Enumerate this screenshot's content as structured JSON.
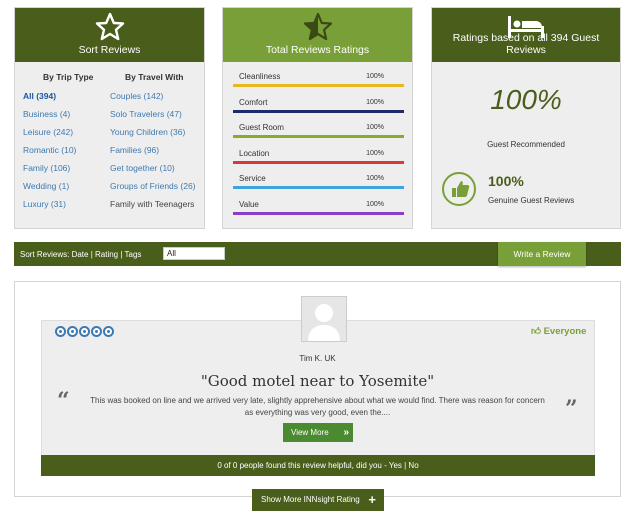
{
  "sort_panel": {
    "title": "Sort Reviews",
    "trip_type_header": "By Trip Type",
    "travel_with_header": "By Travel With",
    "trip_types": [
      "All (394)",
      "Business (4)",
      "Leisure (242)",
      "Romantic (10)",
      "Family (106)",
      "Wedding (1)",
      "Luxury (31)"
    ],
    "travel_with": [
      "Couples (142)",
      "Solo Travelers (47)",
      "Young Children (36)",
      "Families (96)",
      "Get together (10)",
      "Groups of Friends (26)",
      "Family with Teenagers"
    ]
  },
  "ratings_panel": {
    "title": "Total Reviews Ratings",
    "ratings": [
      {
        "label": "Cleanliness",
        "value": "100%",
        "color": "#e8b81e"
      },
      {
        "label": "Comfort",
        "value": "100%",
        "color": "#1d2b6b"
      },
      {
        "label": "Guest Room",
        "value": "100%",
        "color": "#8aaa2a"
      },
      {
        "label": "Location",
        "value": "100%",
        "color": "#d83a3a"
      },
      {
        "label": "Service",
        "value": "100%",
        "color": "#3ea4e0"
      },
      {
        "label": "Value",
        "value": "100%",
        "color": "#8a3ec8"
      }
    ]
  },
  "guest_panel": {
    "title": "Ratings based on all 394 Guest Reviews",
    "big_percent": "100%",
    "recommended_label": "Guest Recommended",
    "genuine_percent": "100%",
    "genuine_label": "Genuine Guest Reviews"
  },
  "sort_bar": {
    "label": "Sort Reviews: Date | Rating | Tags",
    "tag_value": "All",
    "write_review": "Write a Review"
  },
  "review": {
    "everyone_label": "Everyone",
    "reviewer": "Tim K.  UK",
    "title": "\"Good motel near to Yosemite\"",
    "body": "This was booked on line and we arrived very late, slightly apprehensive about what we would find. There was reason for concern as everything was very good, even the....",
    "view_more": "View More",
    "helpful": "0 of 0 people found this review helpful, did you -   Yes   |   No"
  },
  "show_more": "Show More INNsight Rating",
  "colors": {
    "dark_green": "#4a5e1c",
    "light_green": "#79a038",
    "link_blue": "#3d79b0"
  }
}
